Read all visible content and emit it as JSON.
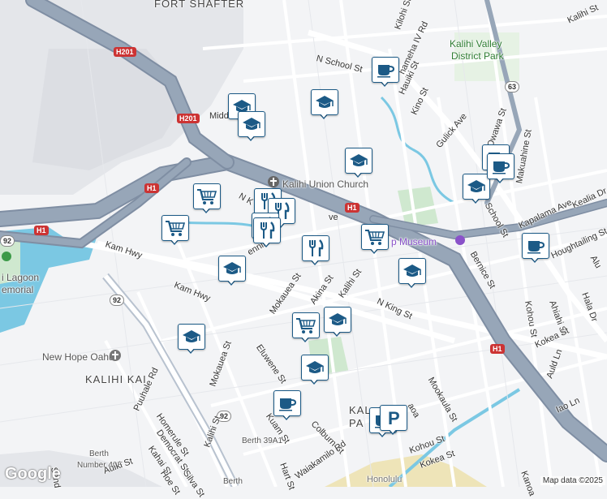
{
  "map": {
    "labels": {
      "fort_shafter": "FORT SHAFTER",
      "kalihi_kai": "KALIHI KAI",
      "kalihi_valley_park_1": "Kalihi Valley",
      "kalihi_valley_park_2": "District Park",
      "kalihi_union_church": "Kalihi Union Church",
      "museum": "p Museum",
      "new_hope": "New Hope Oahu",
      "lagoon_1": "i Lagoon",
      "lagoon_2": "emorial",
      "kal_pa_1": "KAL",
      "kal_pa_2": "PA",
      "honolulu": "Honolulu",
      "berth_40e_1": "Berth",
      "berth_40e_2": "Number 40E",
      "berth_39a1": "Berth 39A1",
      "berth": "Berth",
      "n_school_st": "N School St",
      "kilohi_st": "Kilohi St",
      "kamehameha_iv_rd": "hameha IV Rd",
      "hauiki_st": "Hauiki St",
      "kino_st": "Kino St",
      "gulick_ave": "Gulick Ave",
      "kalihi_st_top": "Kalihi St",
      "owawa_st": "Owawa St",
      "makuahine_st": "Makuahine St",
      "kealia_dr": "Kealia Dr",
      "kapalama_ave": "Kapalama Ave",
      "school_st": "School St",
      "bernice_st": "Bernice St",
      "houghtailing_st": "Houghtailing St",
      "alu": "Alu",
      "kohou_st": "Kohou St",
      "ahiahi_st": "Ahiahi St",
      "hala_dr": "Hala Dr",
      "kokea_st": "Kokea St",
      "auld_ln": "Auld Ln",
      "iao_ln": "Iao Ln",
      "n_king_st_right": "N King St",
      "mookaula_st": "Mookaula St",
      "kamehameha_hwy": "Kam Hwy",
      "kam_hwy_2": "Kam Hwy",
      "mokauea_st": "Mokauea St",
      "mokauea_st_2": "Mokauea St",
      "akina_st": "Akina St",
      "kalihi_st_mid": "Kalihi St",
      "eluwene_st": "Eluwene St",
      "kuam_st": "Kuam St",
      "colburn_st": "Colburn St",
      "waiakamilo_rd": "Waiakamilo Rd",
      "hart_st": "Hart St",
      "puuhale_rd": "Puuhale Rd",
      "homerule_st": "Homerule St",
      "democrat_st": "Democrat St",
      "kahai_st": "Kahai St",
      "hoe_st": "Hoe St",
      "silva_st": "Silva St",
      "auiki_st": "Auiki St",
      "kalihi_st_bottom": "Kalihi St",
      "kohou_st_bottom": "Kohou St",
      "kokea_st_bottom": "Kokea St",
      "kanoa": "Kanoa",
      "middle": "Midd",
      "n_king_partial": "N K",
      "dennis": "ennis",
      "ave": "ve",
      "mookaula_partial": "aoa",
      "sand": "Sand"
    },
    "shields": {
      "h201_a": "H201",
      "h201_b": "H201",
      "h1_a": "H1",
      "h1_b": "H1",
      "h1_c": "H1",
      "h1_d": "H1",
      "r63": "63",
      "r92_a": "92",
      "r92_b": "92",
      "r92_c": "92"
    },
    "colors": {
      "freeway": "#97a6b8",
      "freeway_outline": "#7f8ea3",
      "water": "#7bc8e3",
      "park": "#cfe8cf",
      "industrial": "#e3e5ea",
      "marker_border": "#1c5a86",
      "marker_icon": "#1c5a86"
    },
    "markers": [
      {
        "type": "school-icon"
      },
      {
        "type": "school-icon"
      },
      {
        "type": "school-icon"
      },
      {
        "type": "coffee-icon"
      },
      {
        "type": "school-icon"
      },
      {
        "type": "coffee-icon"
      },
      {
        "type": "school-icon"
      },
      {
        "type": "coffee-icon"
      },
      {
        "type": "coffee-icon"
      },
      {
        "type": "cart-icon"
      },
      {
        "type": "cart-icon"
      },
      {
        "type": "restaurant-icon"
      },
      {
        "type": "restaurant-icon"
      },
      {
        "type": "restaurant-icon"
      },
      {
        "type": "cart-icon"
      },
      {
        "type": "restaurant-icon"
      },
      {
        "type": "restaurant-icon"
      },
      {
        "type": "school-icon"
      },
      {
        "type": "school-icon"
      },
      {
        "type": "school-icon"
      },
      {
        "type": "cart-icon"
      },
      {
        "type": "school-icon"
      },
      {
        "type": "school-icon"
      },
      {
        "type": "coffee-icon"
      },
      {
        "type": "coffee-icon"
      },
      {
        "type": "parking-icon"
      }
    ],
    "attribution": "Map data ©2025",
    "logo": "Google"
  }
}
